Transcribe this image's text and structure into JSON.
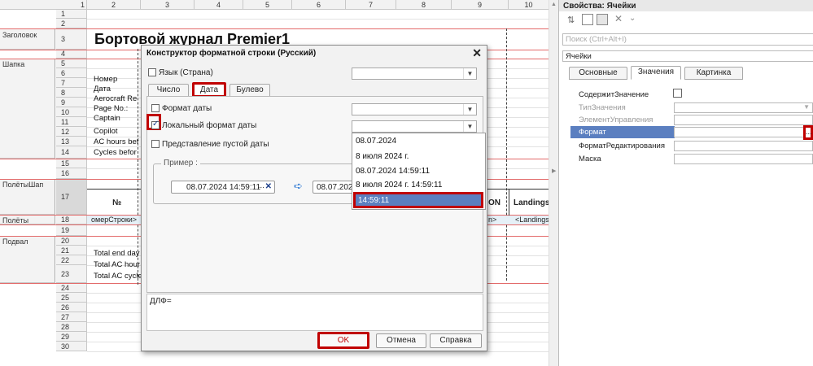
{
  "sheet": {
    "col_headers": [
      "1",
      "2",
      "3",
      "4",
      "5",
      "6",
      "7",
      "8",
      "9",
      "10"
    ],
    "row_numbers": [
      "1",
      "2",
      "3",
      "4",
      "5",
      "6",
      "7",
      "8",
      "9",
      "10",
      "11",
      "12",
      "13",
      "14",
      "15",
      "16",
      "17",
      "18",
      "19",
      "20",
      "21",
      "22",
      "23",
      "24",
      "25",
      "26",
      "27",
      "28",
      "29",
      "30"
    ],
    "groups": [
      "Заголовок",
      "Шапка",
      "ПолётыШап",
      "Полёты",
      "Подвал"
    ],
    "title": "Бортовой журнал Premier1",
    "header_fields": [
      "Номер",
      "Дата",
      "Aerocraft Re",
      "Page No.:",
      "Captain",
      "Copilot",
      "AC hours bef",
      "Cycles befor"
    ],
    "table_no": "№",
    "table_on": "ON",
    "table_landings": "Landings",
    "row_param": "омерСтроки>",
    "row_param_mid": "n>",
    "row_landings": "<Landings",
    "footer_fields": [
      "Total end day",
      "Total AC hour",
      "Total AC cycle"
    ]
  },
  "dialog": {
    "title": "Конструктор форматной строки (Русский)",
    "lang_label": "Язык (Страна)",
    "tabs": [
      "Число",
      "Дата",
      "Булево"
    ],
    "date_format_label": "Формат даты",
    "local_format_label": "Локальный формат даты",
    "empty_date_label": "Представление пустой даты",
    "example_label": "Пример :",
    "example_value": "08.07.2024 14:59:11",
    "example_result": "08.07.2024",
    "dropdown_options": [
      "08.07.2024",
      "8 июля 2024 г.",
      "08.07.2024 14:59:11",
      "8 июля 2024 г. 14:59:11",
      "14:59:11"
    ],
    "dlf_label": "ДЛФ=",
    "ok": "OK",
    "cancel": "Отмена",
    "help": "Справка"
  },
  "panel": {
    "title": "Свойства: Ячейки",
    "search_placeholder": "Поиск (Ctrl+Alt+I)",
    "section": "Ячейки",
    "tabs": [
      "Основные",
      "Значения",
      "Картинка"
    ],
    "props": [
      "СодержитЗначение",
      "ТипЗначения",
      "ЭлементУправления",
      "Формат",
      "ФорматРедактирования",
      "Маска"
    ]
  },
  "colors": {
    "highlight": "#c00000",
    "selection": "#5b7fc0",
    "grid_red": "#e36a6a"
  }
}
